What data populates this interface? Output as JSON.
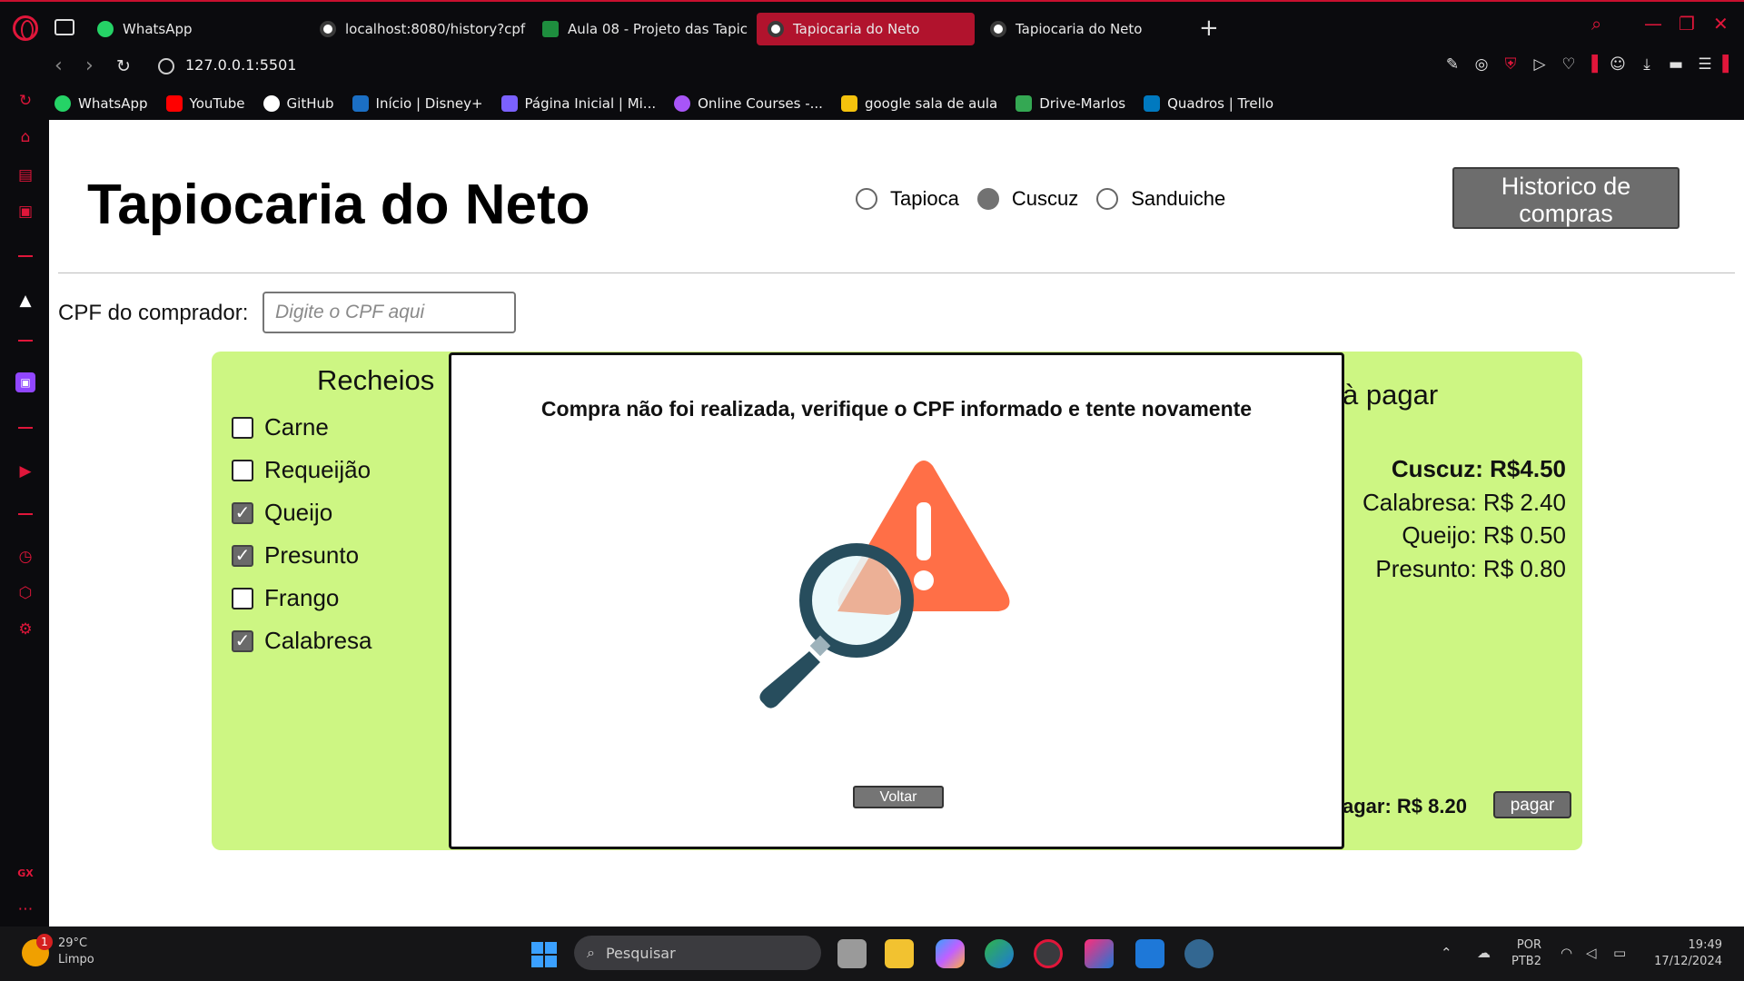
{
  "browser": {
    "tabs": [
      {
        "label": "WhatsApp",
        "icon": "whatsapp-icon",
        "active": false
      },
      {
        "label": "localhost:8080/history?cpf",
        "icon": "globe-icon",
        "active": false
      },
      {
        "label": "Aula 08 - Projeto das Tapic",
        "icon": "classroom-icon",
        "active": false
      },
      {
        "label": "Tapiocaria do Neto",
        "icon": "globe-icon",
        "active": true
      },
      {
        "label": "Tapiocaria do Neto",
        "icon": "globe-icon",
        "active": false
      }
    ],
    "new_tab_symbol": "+",
    "url": "127.0.0.1:5501",
    "bookmarks": [
      {
        "label": "WhatsApp",
        "icon": "whatsapp-icon",
        "color": "#25d366"
      },
      {
        "label": "YouTube",
        "icon": "youtube-icon",
        "color": "#ff0000"
      },
      {
        "label": "GitHub",
        "icon": "github-icon",
        "color": "#ffffff"
      },
      {
        "label": "Início | Disney+",
        "icon": "disney-icon",
        "color": "#1b6fc4"
      },
      {
        "label": "Página Inicial | Mi...",
        "icon": "microsoft-icon",
        "color": "#7b61ff"
      },
      {
        "label": "Online Courses -...",
        "icon": "courses-icon",
        "color": "#a855f7"
      },
      {
        "label": "google sala de aula",
        "icon": "classroom-icon",
        "color": "#f4c20d"
      },
      {
        "label": "Drive-Marlos",
        "icon": "drive-icon",
        "color": "#34a853"
      },
      {
        "label": "Quadros | Trello",
        "icon": "trello-icon",
        "color": "#0079bf"
      }
    ]
  },
  "page": {
    "title": "Tapiocaria do Neto",
    "product_options": [
      {
        "label": "Tapioca",
        "checked": false
      },
      {
        "label": "Cuscuz",
        "checked": true
      },
      {
        "label": "Sanduiche",
        "checked": false
      }
    ],
    "history_button": "Historico de compras",
    "cpf_label": "CPF do comprador:",
    "cpf_placeholder": "Digite o CPF aqui",
    "fillings_title": "Recheios",
    "fillings": [
      {
        "label": "Carne",
        "checked": false
      },
      {
        "label": "Requeijão",
        "checked": false
      },
      {
        "label": "Queijo",
        "checked": true
      },
      {
        "label": "Presunto",
        "checked": true
      },
      {
        "label": "Frango",
        "checked": false
      },
      {
        "label": "Calabresa",
        "checked": true
      }
    ],
    "payment_title": "à pagar",
    "price_lines": [
      {
        "label": "Cuscuz: R$4.50"
      },
      {
        "label": "Calabresa: R$ 2.40"
      },
      {
        "label": "Queijo: R$ 0.50"
      },
      {
        "label": "Presunto: R$ 0.80"
      }
    ],
    "total_visible": "agar: R$ 8.20",
    "pay_button": "pagar"
  },
  "modal": {
    "message": "Compra não foi realizada, verifique o CPF informado e tente novamente",
    "illustration": "magnifier-warning-icon",
    "back_button": "Voltar"
  },
  "taskbar": {
    "weather_badge": "1",
    "weather_temp": "29°C",
    "weather_desc": "Limpo",
    "search_placeholder": "Pesquisar",
    "lang_top": "POR",
    "lang_bottom": "PTB2",
    "time": "19:49",
    "date": "17/12/2024"
  },
  "colors": {
    "accent": "#b1132d",
    "panel": "#cdf683",
    "button": "#6d6d6d",
    "warning": "#ff6f47"
  }
}
